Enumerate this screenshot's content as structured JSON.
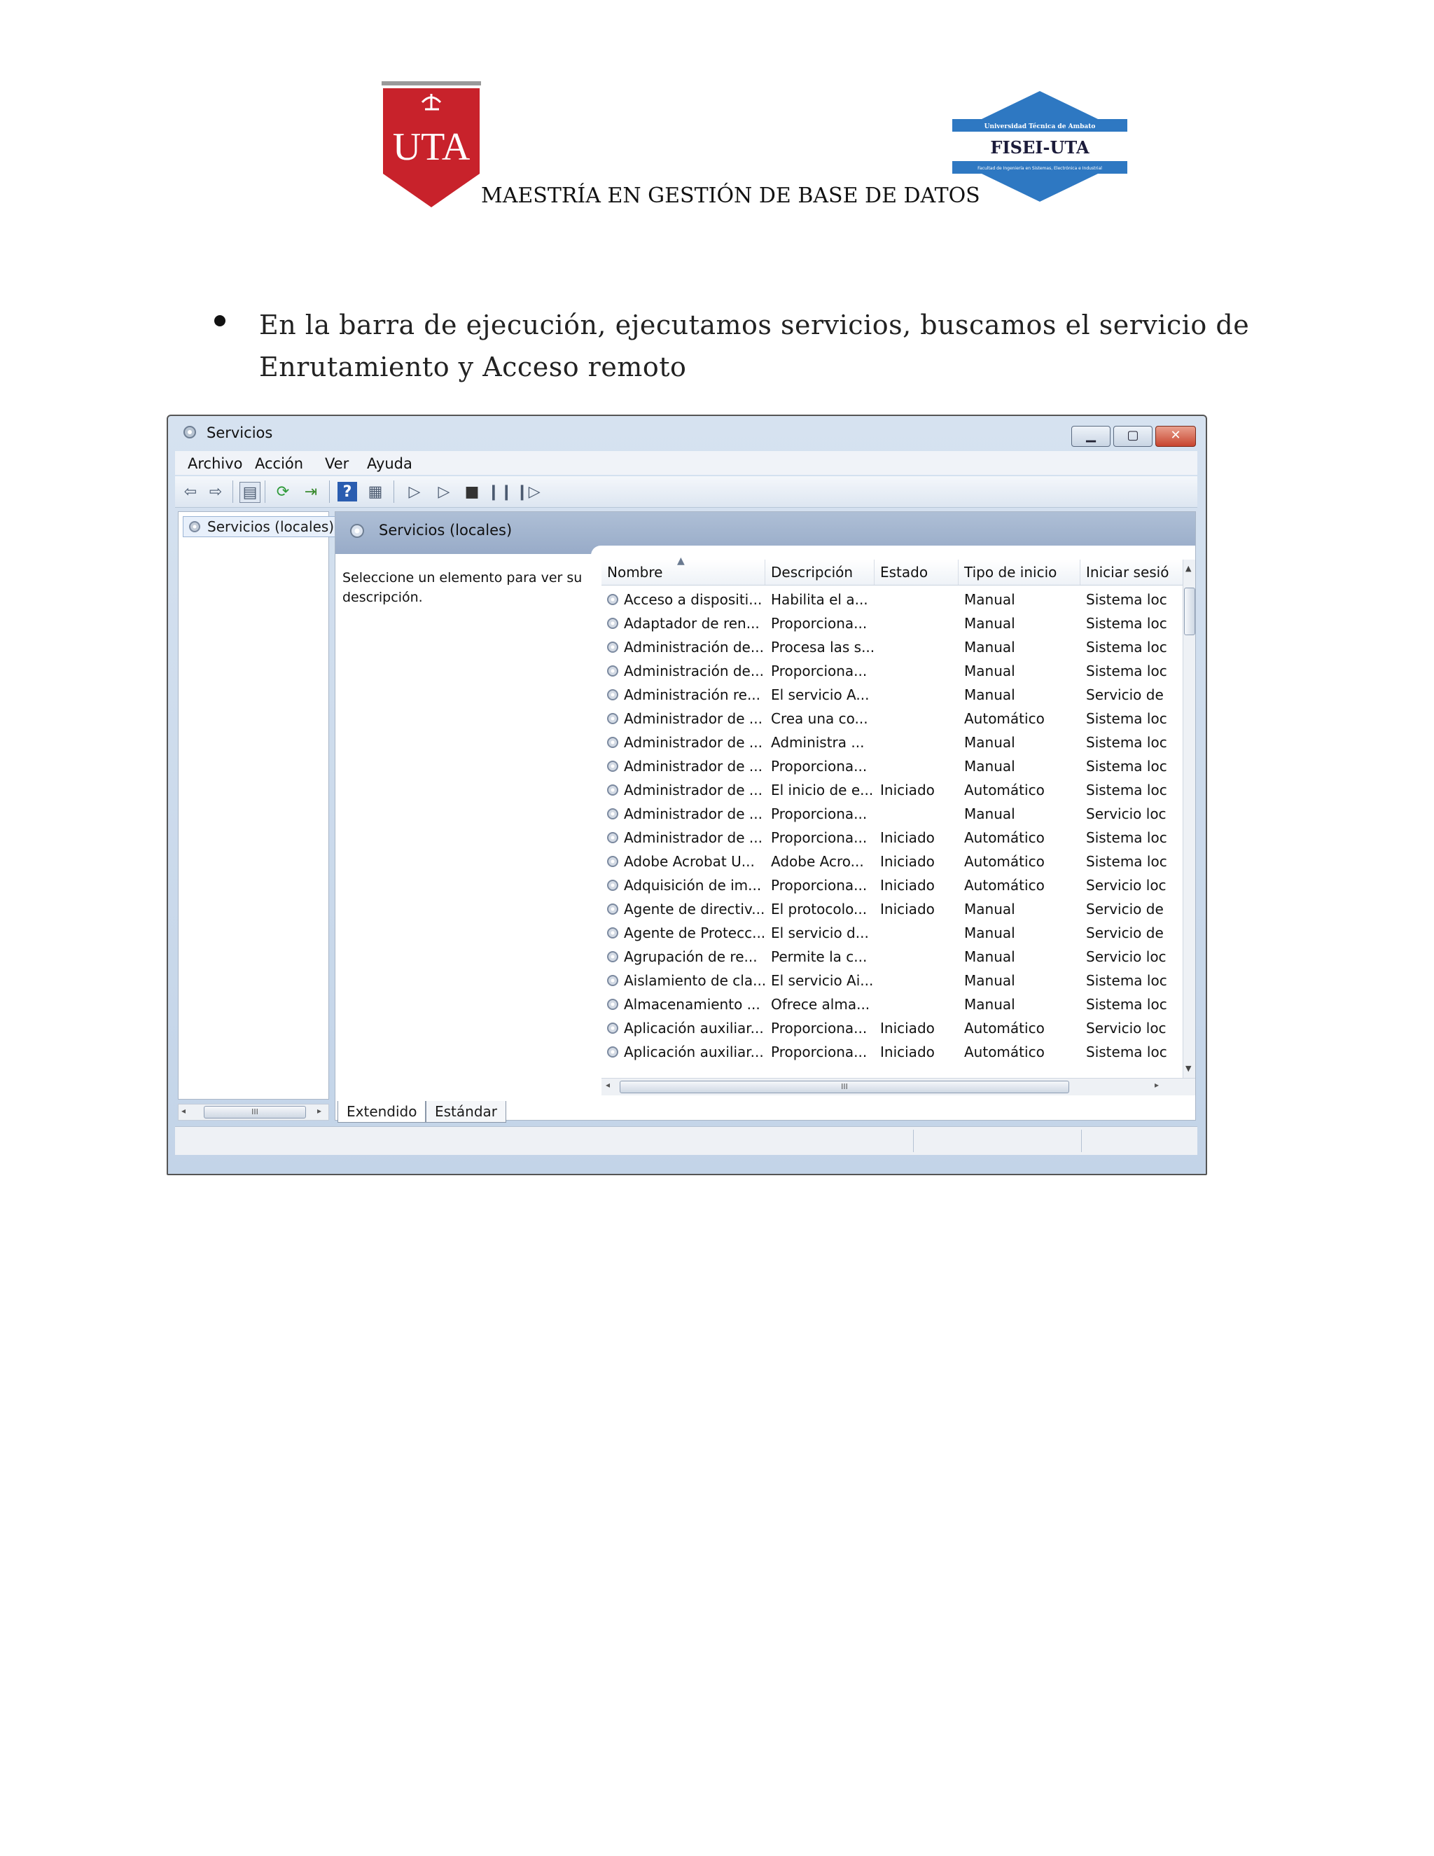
{
  "document": {
    "header_title": "MAESTRÍA EN GESTIÓN DE BASE DE DATOS",
    "uta_logo_text": "UTA",
    "fisei_logo_top": "Universidad Técnica de Ambato",
    "fisei_logo_main": "FISEI-UTA",
    "fisei_logo_bottom": "Facultad de Ingeniería en Sistemas, Electrónica e Industrial",
    "bullet_text": "En la barra de ejecución, ejecutamos servicios, buscamos el servicio de Enrutamiento y Acceso remoto"
  },
  "window": {
    "title": "Servicios",
    "menu": [
      "Archivo",
      "Acción",
      "Ver",
      "Ayuda"
    ],
    "tree_node": "Servicios (locales)",
    "content_title": "Servicios (locales)",
    "description_hint": "Seleccione un elemento para ver su descripción.",
    "columns": [
      "Nombre",
      "Descripción",
      "Estado",
      "Tipo de inicio",
      "Iniciar sesió"
    ],
    "rows": [
      [
        "Acceso a dispositi...",
        "Habilita el a...",
        "",
        "Manual",
        "Sistema loc"
      ],
      [
        "Adaptador de ren...",
        "Proporciona...",
        "",
        "Manual",
        "Sistema loc"
      ],
      [
        "Administración de...",
        "Procesa las s...",
        "",
        "Manual",
        "Sistema loc"
      ],
      [
        "Administración de...",
        "Proporciona...",
        "",
        "Manual",
        "Sistema loc"
      ],
      [
        "Administración re...",
        "El servicio A...",
        "",
        "Manual",
        "Servicio de"
      ],
      [
        "Administrador de ...",
        "Crea una co...",
        "",
        "Automático",
        "Sistema loc"
      ],
      [
        "Administrador de ...",
        "Administra ...",
        "",
        "Manual",
        "Sistema loc"
      ],
      [
        "Administrador de ...",
        "Proporciona...",
        "",
        "Manual",
        "Sistema loc"
      ],
      [
        "Administrador de ...",
        "El inicio de e...",
        "Iniciado",
        "Automático",
        "Sistema loc"
      ],
      [
        "Administrador de ...",
        "Proporciona...",
        "",
        "Manual",
        "Servicio loc"
      ],
      [
        "Administrador de ...",
        "Proporciona...",
        "Iniciado",
        "Automático",
        "Sistema loc"
      ],
      [
        "Adobe Acrobat U...",
        "Adobe Acro...",
        "Iniciado",
        "Automático",
        "Sistema loc"
      ],
      [
        "Adquisición de im...",
        "Proporciona...",
        "Iniciado",
        "Automático",
        "Servicio loc"
      ],
      [
        "Agente de directiv...",
        "El protocolo...",
        "Iniciado",
        "Manual",
        "Servicio de"
      ],
      [
        "Agente de Protecc...",
        "El servicio d...",
        "",
        "Manual",
        "Servicio de"
      ],
      [
        "Agrupación de re...",
        "Permite la c...",
        "",
        "Manual",
        "Servicio loc"
      ],
      [
        "Aislamiento de cla...",
        "El servicio Ai...",
        "",
        "Manual",
        "Sistema loc"
      ],
      [
        "Almacenamiento ...",
        "Ofrece alma...",
        "",
        "Manual",
        "Sistema loc"
      ],
      [
        "Aplicación auxiliar...",
        "Proporciona...",
        "Iniciado",
        "Automático",
        "Servicio loc"
      ],
      [
        "Aplicación auxiliar...",
        "Proporciona...",
        "Iniciado",
        "Automático",
        "Sistema loc"
      ]
    ],
    "tabs": [
      "Extendido",
      "Estándar"
    ],
    "scroll_grip": "III"
  }
}
